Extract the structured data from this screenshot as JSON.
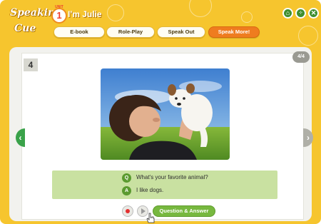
{
  "header": {
    "logo_line1": "Speaking",
    "logo_line2": "Cue",
    "unit_label": "UNIT",
    "unit_number": "1",
    "unit_title": "I'm Julie"
  },
  "nav": [
    {
      "label": "E-book"
    },
    {
      "label": "Role-Play"
    },
    {
      "label": "Speak Out"
    },
    {
      "label": "Speak More!"
    }
  ],
  "controls": {
    "home_icon": "home-icon",
    "menu_icon": "menu-icon",
    "close_icon": "close-icon"
  },
  "content": {
    "page_number": "4",
    "page_count": "4/4",
    "photo": "boy-holding-puppy",
    "question": "What's your favorite animal?",
    "answer": "I like dogs.",
    "question_badge": "Q",
    "answer_badge": "A",
    "qa_button_label": "Question & Answer"
  },
  "colors": {
    "frame": "#f6c52e",
    "active_tab": "#ef7c1f",
    "accent_green": "#77b83f",
    "qa_bg": "#c9e1a1"
  }
}
